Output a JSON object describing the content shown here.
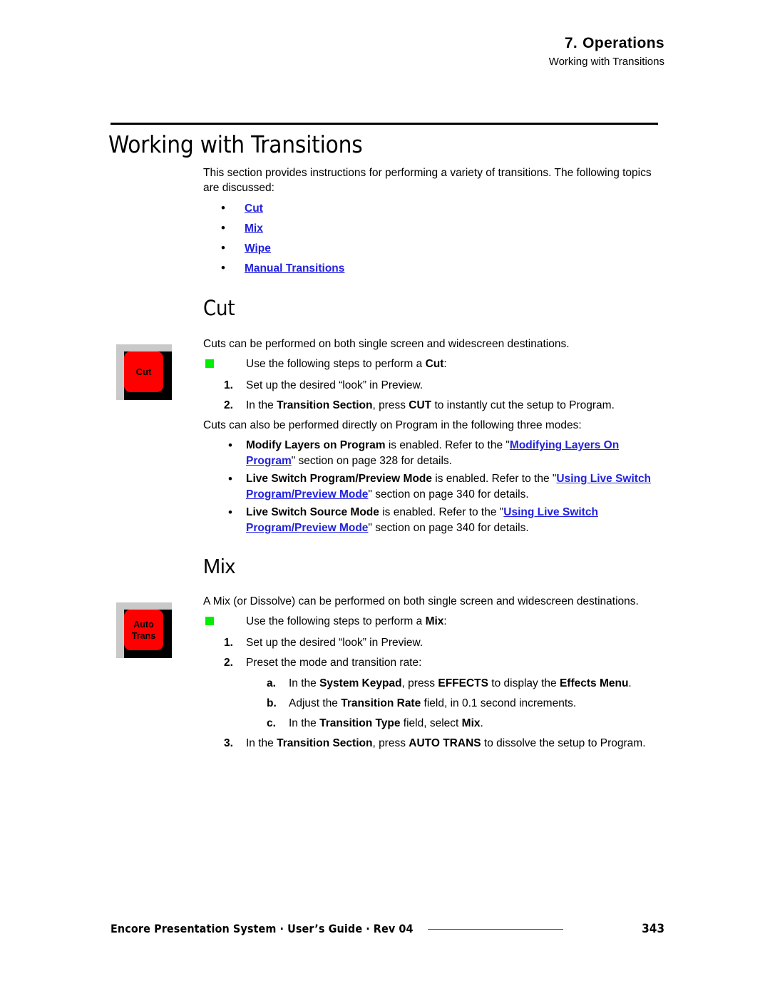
{
  "header": {
    "chapter_number": "7.",
    "chapter_title": "Operations",
    "section_title": "Working with Transitions"
  },
  "title": "Working with Transitions",
  "intro": "This section provides instructions for performing a variety of transitions.  The following topics are discussed:",
  "topic_links": [
    {
      "bullet": "•",
      "label": "Cut"
    },
    {
      "bullet": "•",
      "label": "Mix"
    },
    {
      "bullet": "•",
      "label": "Wipe"
    },
    {
      "bullet": "•",
      "label": "Manual Transitions"
    }
  ],
  "cut_section": {
    "heading": "Cut",
    "key_label_line1": "Cut",
    "intro": "Cuts can be performed on both single screen and widescreen destinations.",
    "bullet_lead_plain1": "Use the following steps to perform a ",
    "bullet_lead_bold": "Cut",
    "bullet_lead_plain2": ":",
    "steps": [
      {
        "marker": "1.",
        "text": "Set up the desired “look” in Preview."
      },
      {
        "marker": "2.",
        "text": "In the Transition Section, press CUT to instantly cut the setup to Program."
      }
    ],
    "modes_intro": "Cuts can also be performed directly on Program in the following three modes:",
    "modes": [
      {
        "bullet": "•",
        "bold_lead": "Modify Layers on Program",
        "mid": " is enabled.  Refer to the \"",
        "link": "Modifying Layers On Program",
        "tail": "\" section on page 328 for details."
      },
      {
        "bullet": "•",
        "bold_lead": "Live Switch Program/Preview Mode",
        "mid": " is enabled.  Refer to the \"",
        "link": "Using Live Switch Program/Preview Mode",
        "tail": "\" section on page 340 for details."
      },
      {
        "bullet": "•",
        "bold_lead": "Live Switch Source Mode",
        "mid": " is enabled.  Refer to the \"",
        "link": "Using Live Switch Program/Preview Mode",
        "tail": "\" section on page 340 for details."
      }
    ]
  },
  "mix_section": {
    "heading": "Mix",
    "key_label_line1": "Auto",
    "key_label_line2": "Trans",
    "intro": "A Mix (or Dissolve) can be performed on both single screen and widescreen destinations.",
    "bullet_lead_plain1": "Use the following steps to perform a ",
    "bullet_lead_bold": "Mix",
    "bullet_lead_plain2": ":",
    "step1": {
      "marker": "1.",
      "text": "Set up the desired “look” in Preview."
    },
    "step2": {
      "marker": "2.",
      "text": "Preset the mode and transition rate:"
    },
    "substeps": [
      {
        "marker": "a.",
        "p1": "In the ",
        "b1": "System Keypad",
        "p2": ", press ",
        "b2": "EFFECTS",
        "p3": " to display the ",
        "b3": "Effects Menu",
        "p4": "."
      },
      {
        "marker": "b.",
        "p1": "Adjust the ",
        "b1": "Transition Rate",
        "p2": " field, in 0.1 second increments.",
        "b2": "",
        "p3": "",
        "b3": "",
        "p4": ""
      },
      {
        "marker": "c.",
        "p1": "In the ",
        "b1": "Transition Type",
        "p2": " field, select ",
        "b2": "Mix",
        "p3": ".",
        "b3": "",
        "p4": ""
      }
    ],
    "step3": {
      "marker": "3.",
      "p1": "In the ",
      "b1": "Transition Section",
      "p2": ", press ",
      "b2": "AUTO TRANS",
      "p3": " to dissolve the setup to Program."
    }
  },
  "footer": {
    "product": "Encore Presentation System",
    "sep1": "·",
    "guide": "User’s Guide",
    "sep2": "·",
    "revision": "Rev 04",
    "page_number": "343"
  },
  "colors": {
    "link": "#2222dd",
    "key_cap": "#ff0000",
    "key_bezel": "#000000",
    "key_bevel": "#c9c9c9",
    "bullet_square": "#00ee00"
  }
}
